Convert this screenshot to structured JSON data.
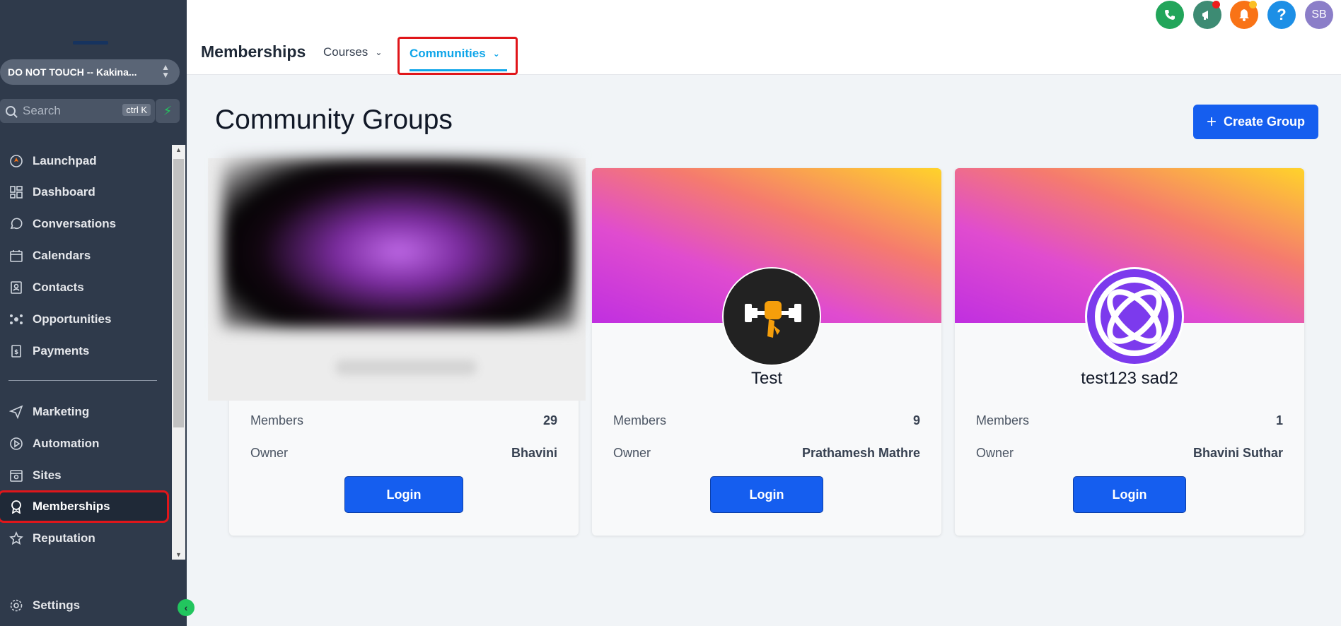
{
  "sidebar": {
    "account_name": "DO NOT TOUCH -- Kakina...",
    "search_placeholder": "Search",
    "search_shortcut": "ctrl K",
    "items": [
      {
        "label": "Launchpad",
        "icon": "rocket-icon"
      },
      {
        "label": "Dashboard",
        "icon": "grid-icon"
      },
      {
        "label": "Conversations",
        "icon": "chat-icon"
      },
      {
        "label": "Calendars",
        "icon": "calendar-icon"
      },
      {
        "label": "Contacts",
        "icon": "contacts-icon"
      },
      {
        "label": "Opportunities",
        "icon": "opportunities-icon"
      },
      {
        "label": "Payments",
        "icon": "payments-icon"
      },
      {
        "label": "Marketing",
        "icon": "send-icon"
      },
      {
        "label": "Automation",
        "icon": "automation-icon"
      },
      {
        "label": "Sites",
        "icon": "sites-icon"
      },
      {
        "label": "Memberships",
        "icon": "badge-icon",
        "active": true
      },
      {
        "label": "Reputation",
        "icon": "star-icon"
      }
    ],
    "settings_label": "Settings"
  },
  "header": {
    "title": "Memberships",
    "tabs": [
      {
        "label": "Courses"
      },
      {
        "label": "Communities",
        "active": true
      }
    ],
    "avatar_initials": "SB",
    "icon_colors": {
      "phone": "#22a55a",
      "megaphone": "#3d8b73",
      "bell": "#f97316",
      "help": "#1d8fe6",
      "avatar": "#8b7ec8"
    }
  },
  "main": {
    "title": "Community Groups",
    "create_button": "Create Group",
    "cards": [
      {
        "name": "",
        "members_label": "Members",
        "members": "29",
        "owner_label": "Owner",
        "owner": "Bhavini",
        "login_label": "Login"
      },
      {
        "name": "Test",
        "members_label": "Members",
        "members": "9",
        "owner_label": "Owner",
        "owner": "Prathamesh Mathre",
        "login_label": "Login"
      },
      {
        "name": "test123 sad2",
        "members_label": "Members",
        "members": "1",
        "owner_label": "Owner",
        "owner": "Bhavini Suthar",
        "login_label": "Login"
      }
    ]
  },
  "colors": {
    "accent": "#155eef",
    "highlight": "#e0161a",
    "sidebar_bg": "#2f3a4b"
  }
}
